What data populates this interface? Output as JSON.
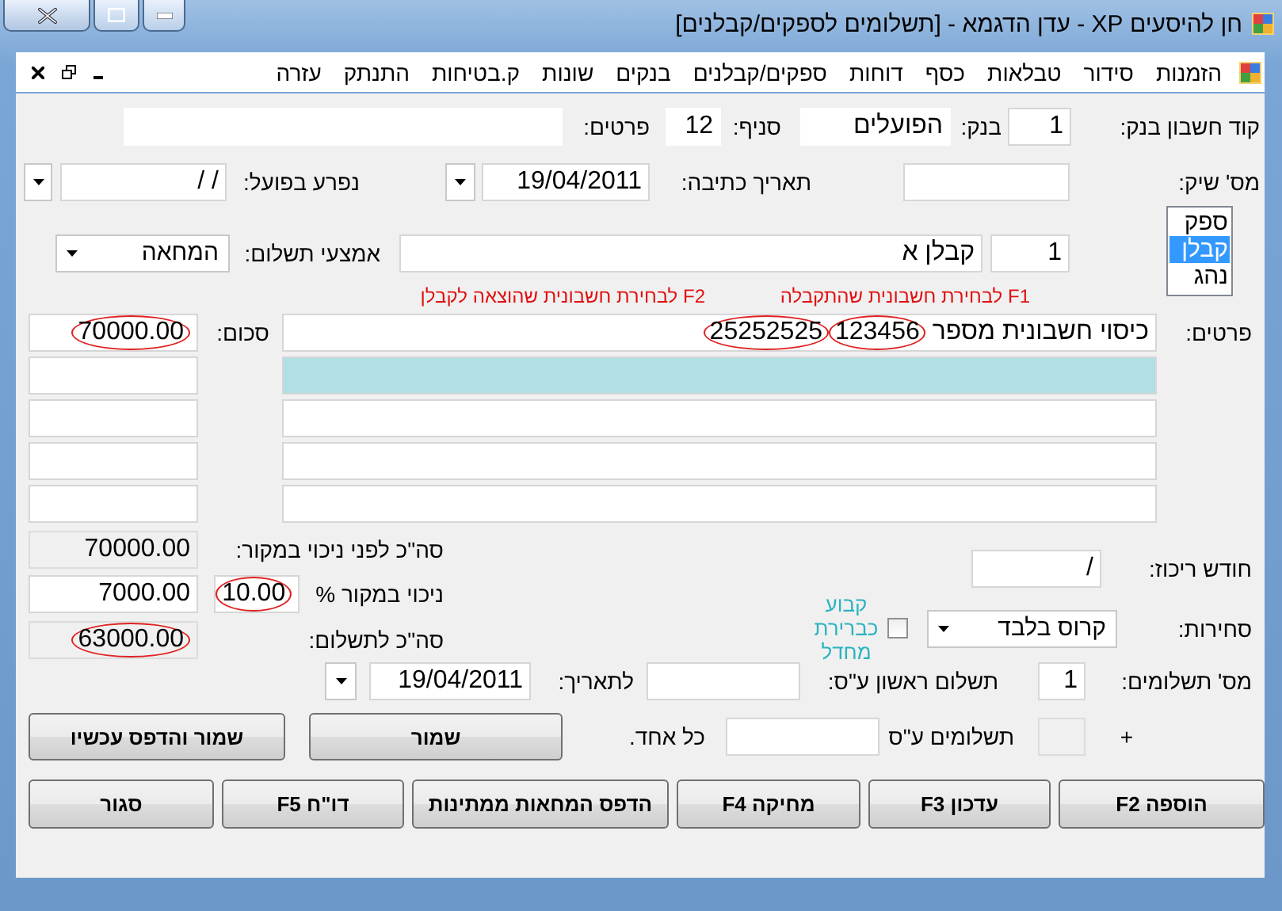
{
  "window": {
    "title": "חן להיסעים XP - עדן הדגמא - [תשלומים לספקים/קבלנים]"
  },
  "menu": [
    "הזמנות",
    "סידור",
    "טבלאות",
    "כסף",
    "דוחות",
    "ספקים/קבלנים",
    "בנקים",
    "שונות",
    "ק.בטיחות",
    "התנתק",
    "עזרה"
  ],
  "bank": {
    "code_label": "קוד חשבון בנק:",
    "code": "1",
    "bank_label": "בנק:",
    "bank": "הפועלים",
    "branch_label": "סניף:",
    "branch": "12",
    "details_label": "פרטים:"
  },
  "check": {
    "number_label": "מס' שיק:",
    "written_label": "תאריך כתיבה:",
    "written_date": "19/04/2011",
    "cleared_label": "נפרע בפועל:",
    "cleared_date": "/  /"
  },
  "payee_types": [
    {
      "label": "ספק",
      "selected": false
    },
    {
      "label": "קבלן",
      "selected": true
    },
    {
      "label": "נהג",
      "selected": false
    }
  ],
  "payee": {
    "number": "1",
    "name": "קבלן א",
    "method_label": "אמצעי תשלום:",
    "method": "המחאה"
  },
  "hints": [
    "F1 לבחירת חשבונית שהתקבלה",
    "F2 לבחירת חשבונית שהוצאה לקבלן"
  ],
  "lines": {
    "details_label": "פרטים:",
    "amount_label": "סכום:",
    "rows": [
      {
        "selected": false,
        "details": [
          {
            "text": "כיסוי חשבונית מספר",
            "circled": false
          },
          {
            "text": "123456",
            "circled": true
          },
          {
            "text": "25252525",
            "circled": true
          }
        ],
        "amount": {
          "value": "70000.00",
          "circled": true
        }
      },
      {
        "selected": true
      },
      {
        "selected": false
      },
      {
        "selected": false
      },
      {
        "selected": false
      }
    ]
  },
  "totals": {
    "before_label": "סה\"כ לפני ניכוי במקור:",
    "before": {
      "value": "70000.00",
      "circled": false,
      "disabled": true
    },
    "withholding_label": "ניכוי במקור %",
    "withholding_percent": {
      "value": "10.00",
      "circled": true,
      "disabled": false
    },
    "withholding_amount": {
      "value": "7000.00",
      "circled": false,
      "disabled": false
    },
    "total_label": "סה\"כ לתשלום:",
    "total": {
      "value": "63000.00",
      "circled": true,
      "disabled": true
    }
  },
  "concentration": {
    "month_label": "חודש ריכוז:",
    "month": "/"
  },
  "negotiability": {
    "label": "סחירות:",
    "value": "קרוס בלבד",
    "default_checked": false,
    "default_label": "קבוע כברירת מחדל"
  },
  "payments": {
    "count_label": "מס' תשלומים:",
    "count": "1",
    "first_label": "תשלום ראשון ע\"ס:",
    "to_date_label": "לתאריך:",
    "to_date": "19/04/2011",
    "plus": "+",
    "each_count": {
      "disabled": true
    },
    "each_label": "תשלומים ע\"ס",
    "each_suffix": "כל אחד."
  },
  "save_buttons": [
    "שמור",
    "שמור והדפס עכשיו"
  ],
  "buttons": [
    "הוספה F2",
    "עדכון F3",
    "מחיקה F4",
    "הדפס המחאות ממתינות",
    "דו\"ח F5",
    "סגור"
  ]
}
